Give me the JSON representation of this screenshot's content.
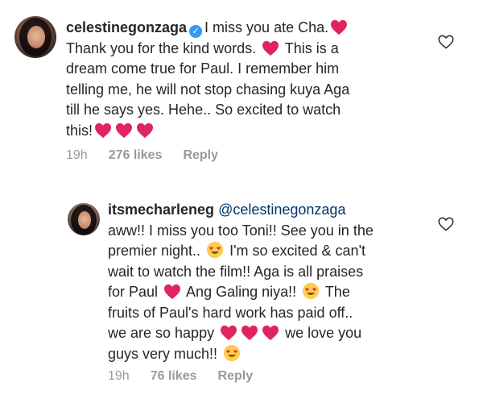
{
  "comments": [
    {
      "username": "celestinegonzaga",
      "verified": true,
      "lines": [
        [
          "I miss you ate Cha.",
          "heart"
        ],
        [
          "Thank you for the kind words. ",
          "heart",
          "  This is a"
        ],
        [
          "dream come true for Paul. I remember him"
        ],
        [
          "telling me, he will not stop chasing kuya Aga"
        ],
        [
          "till he says yes. Hehe.. So excited to watch"
        ],
        [
          "this!",
          "heart",
          "heart",
          "heart"
        ]
      ],
      "time": "19h",
      "likes": "276 likes",
      "reply": "Reply"
    },
    {
      "username": "itsmecharleneg",
      "mention": "@celestinegonzaga",
      "lines": [
        [
          "aww!! I miss you too Toni!! See you in the"
        ],
        [
          "premier night.. ",
          "hearteyes",
          " I'm so excited & can't"
        ],
        [
          "wait to watch the film!! Aga is all praises"
        ],
        [
          "for Paul ",
          "heart",
          " Ang Galing niya!! ",
          "hearteyes",
          " The"
        ],
        [
          "fruits of Paul's hard work has paid off.."
        ],
        [
          "we are so happy ",
          "heart",
          "heart",
          "heart",
          "  we love you"
        ],
        [
          "guys very much!! ",
          "hearteyes"
        ]
      ],
      "time": "19h",
      "likes": "76 likes",
      "reply": "Reply"
    }
  ],
  "icons": {
    "heart": "red-heart-icon",
    "hearteyes": "heart-eyes-emoji-icon",
    "like": "heart-outline-icon"
  },
  "colors": {
    "text": "#262626",
    "meta": "#999999",
    "mention": "#003569",
    "verified": "#3897f0",
    "heart": "#e0245e"
  }
}
